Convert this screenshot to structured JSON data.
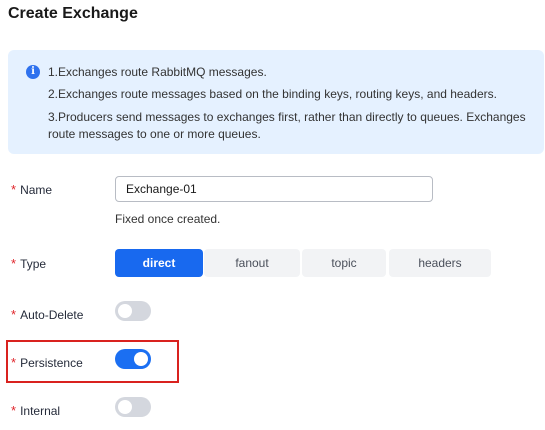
{
  "page": {
    "title": "Create Exchange"
  },
  "info": {
    "icon": "info-icon",
    "lines": [
      "1.Exchanges route RabbitMQ messages.",
      "2.Exchanges route messages based on the binding keys, routing keys, and headers.",
      "3.Producers send messages to exchanges first, rather than directly to queues. Exchanges route messages to one or more queues."
    ]
  },
  "form": {
    "required_mark": "*",
    "name": {
      "label": "Name",
      "value": "Exchange-01",
      "hint": "Fixed once created."
    },
    "type": {
      "label": "Type",
      "options": [
        "direct",
        "fanout",
        "topic",
        "headers"
      ],
      "selected": "direct"
    },
    "auto_delete": {
      "label": "Auto-Delete",
      "on": false
    },
    "persistence": {
      "label": "Persistence",
      "on": true
    },
    "internal": {
      "label": "Internal",
      "on": false
    }
  },
  "colors": {
    "accent": "#1869ef",
    "required": "#e0242a",
    "info_bg": "#e5f1ff",
    "highlight": "#d9221f"
  }
}
